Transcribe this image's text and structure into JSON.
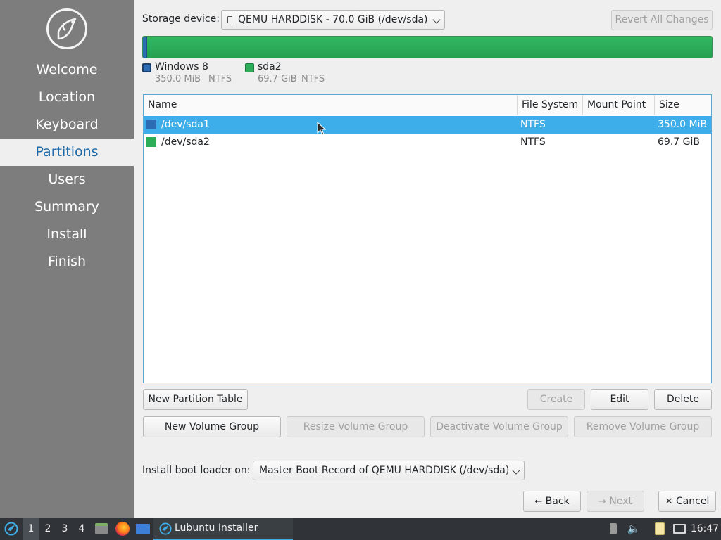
{
  "sidebar": {
    "items": [
      {
        "label": "Welcome"
      },
      {
        "label": "Location"
      },
      {
        "label": "Keyboard"
      },
      {
        "label": "Partitions"
      },
      {
        "label": "Users"
      },
      {
        "label": "Summary"
      },
      {
        "label": "Install"
      },
      {
        "label": "Finish"
      }
    ],
    "active": "Partitions"
  },
  "storage": {
    "label": "Storage device:",
    "device": "QEMU HARDDISK - 70.0 GiB (/dev/sda)",
    "revert_label": "Revert All Changes"
  },
  "legend": [
    {
      "name": "Windows 8",
      "size": "350.0 MiB",
      "fs": "NTFS",
      "color": "#2b6cb4"
    },
    {
      "name": "sda2",
      "size": "69.7 GiB",
      "fs": "NTFS",
      "color": "#2ead59"
    }
  ],
  "table": {
    "columns": [
      "Name",
      "File System",
      "Mount Point",
      "Size"
    ],
    "rows": [
      {
        "name": "/dev/sda1",
        "fs": "NTFS",
        "mount": "",
        "size": "350.0 MiB",
        "color": "#2b6cb4",
        "selected": true
      },
      {
        "name": "/dev/sda2",
        "fs": "NTFS",
        "mount": "",
        "size": "69.7 GiB",
        "color": "#2ead59",
        "selected": false
      }
    ]
  },
  "actions": {
    "new_partition_table": "New Partition Table",
    "create": "Create",
    "edit": "Edit",
    "delete": "Delete",
    "new_volume_group": "New Volume Group",
    "resize_volume_group": "Resize Volume Group",
    "deactivate_volume_group": "Deactivate Volume Group",
    "remove_volume_group": "Remove Volume Group"
  },
  "bootloader": {
    "label": "Install boot loader on:",
    "value": "Master Boot Record of QEMU HARDDISK (/dev/sda)"
  },
  "nav": {
    "back": "Back",
    "next": "Next",
    "cancel": "Cancel"
  },
  "taskbar": {
    "desktops": [
      "1",
      "2",
      "3",
      "4"
    ],
    "active_desktop": "1",
    "task_title": "Lubuntu Installer",
    "clock": "16:47"
  },
  "colors": {
    "accent": "#3daee9",
    "sidebar_bg": "#7d7d7d",
    "active_text": "#1e6aa8",
    "taskbar_bg": "#303438"
  }
}
